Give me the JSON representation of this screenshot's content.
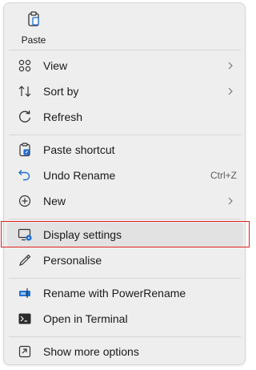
{
  "menu": {
    "top_action": {
      "label": "Paste",
      "icon": "clipboard-icon"
    },
    "items": [
      {
        "label": "View",
        "icon": "grid-icon",
        "has_submenu": true
      },
      {
        "label": "Sort by",
        "icon": "sort-icon",
        "has_submenu": true
      },
      {
        "label": "Refresh",
        "icon": "refresh-icon"
      },
      {
        "label": "Paste shortcut",
        "icon": "paste-shortcut-icon"
      },
      {
        "label": "Undo Rename",
        "icon": "undo-icon",
        "shortcut": "Ctrl+Z"
      },
      {
        "label": "New",
        "icon": "plus-circle-icon",
        "has_submenu": true
      },
      {
        "label": "Display settings",
        "icon": "display-settings-icon",
        "highlighted": true
      },
      {
        "label": "Personalise",
        "icon": "pen-icon"
      },
      {
        "label": "Rename with PowerRename",
        "icon": "powerrename-icon"
      },
      {
        "label": "Open in Terminal",
        "icon": "terminal-icon"
      },
      {
        "label": "Show more options",
        "icon": "more-options-icon"
      }
    ]
  },
  "colors": {
    "menu_bg": "#eeeeee",
    "highlight_border": "#e02222",
    "accent_blue": "#1f6fd1"
  }
}
